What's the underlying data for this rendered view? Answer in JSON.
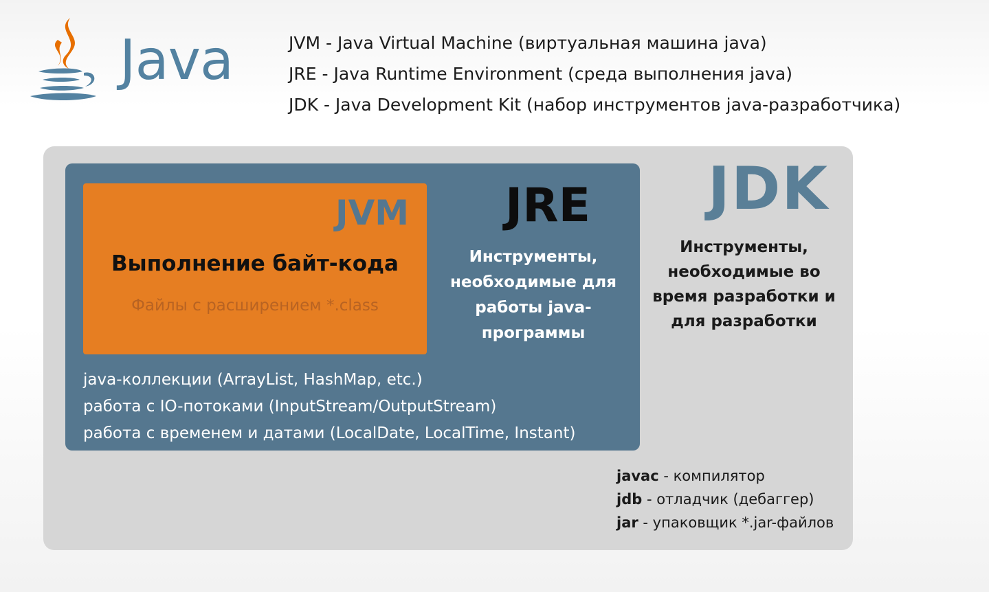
{
  "logo": {
    "wordmark": "Java",
    "icon": "java-coffee-cup-icon",
    "colors": {
      "steam": "#e76f00",
      "cup": "#5382a1"
    }
  },
  "definitions": [
    "JVM - Java Virtual Machine (виртуальная машина java)",
    "JRE - Java Runtime Environment (среда выполнения java)",
    "JDK - Java Development Kit (набор инструментов java-разработчика)"
  ],
  "jdk": {
    "title": "JDK",
    "description": "Инструменты, необходимые во время разработки и для разработки",
    "tools": [
      {
        "name": "javac",
        "desc": " - компилятор"
      },
      {
        "name": "jdb",
        "desc": " - отладчик (дебаггер)"
      },
      {
        "name": "jar",
        "desc": " - упаковщик *.jar-файлов"
      }
    ],
    "color": "#d6d6d6",
    "title_color": "#5a7f97"
  },
  "jre": {
    "title": "JRE",
    "description": "Инструменты, необходимые для работы java-программы",
    "libraries": [
      "java-коллекции (ArrayList, HashMap, etc.)",
      "работа с IO-потоками (InputStream/OutputStream)",
      "работа с временем и датами (LocalDate, LocalTime, Instant)"
    ],
    "color": "#55778f"
  },
  "jvm": {
    "title": "JVM",
    "description": "Выполнение байт-кода",
    "subtitle": "Файлы с расширением *.class",
    "color": "#e67e22"
  }
}
